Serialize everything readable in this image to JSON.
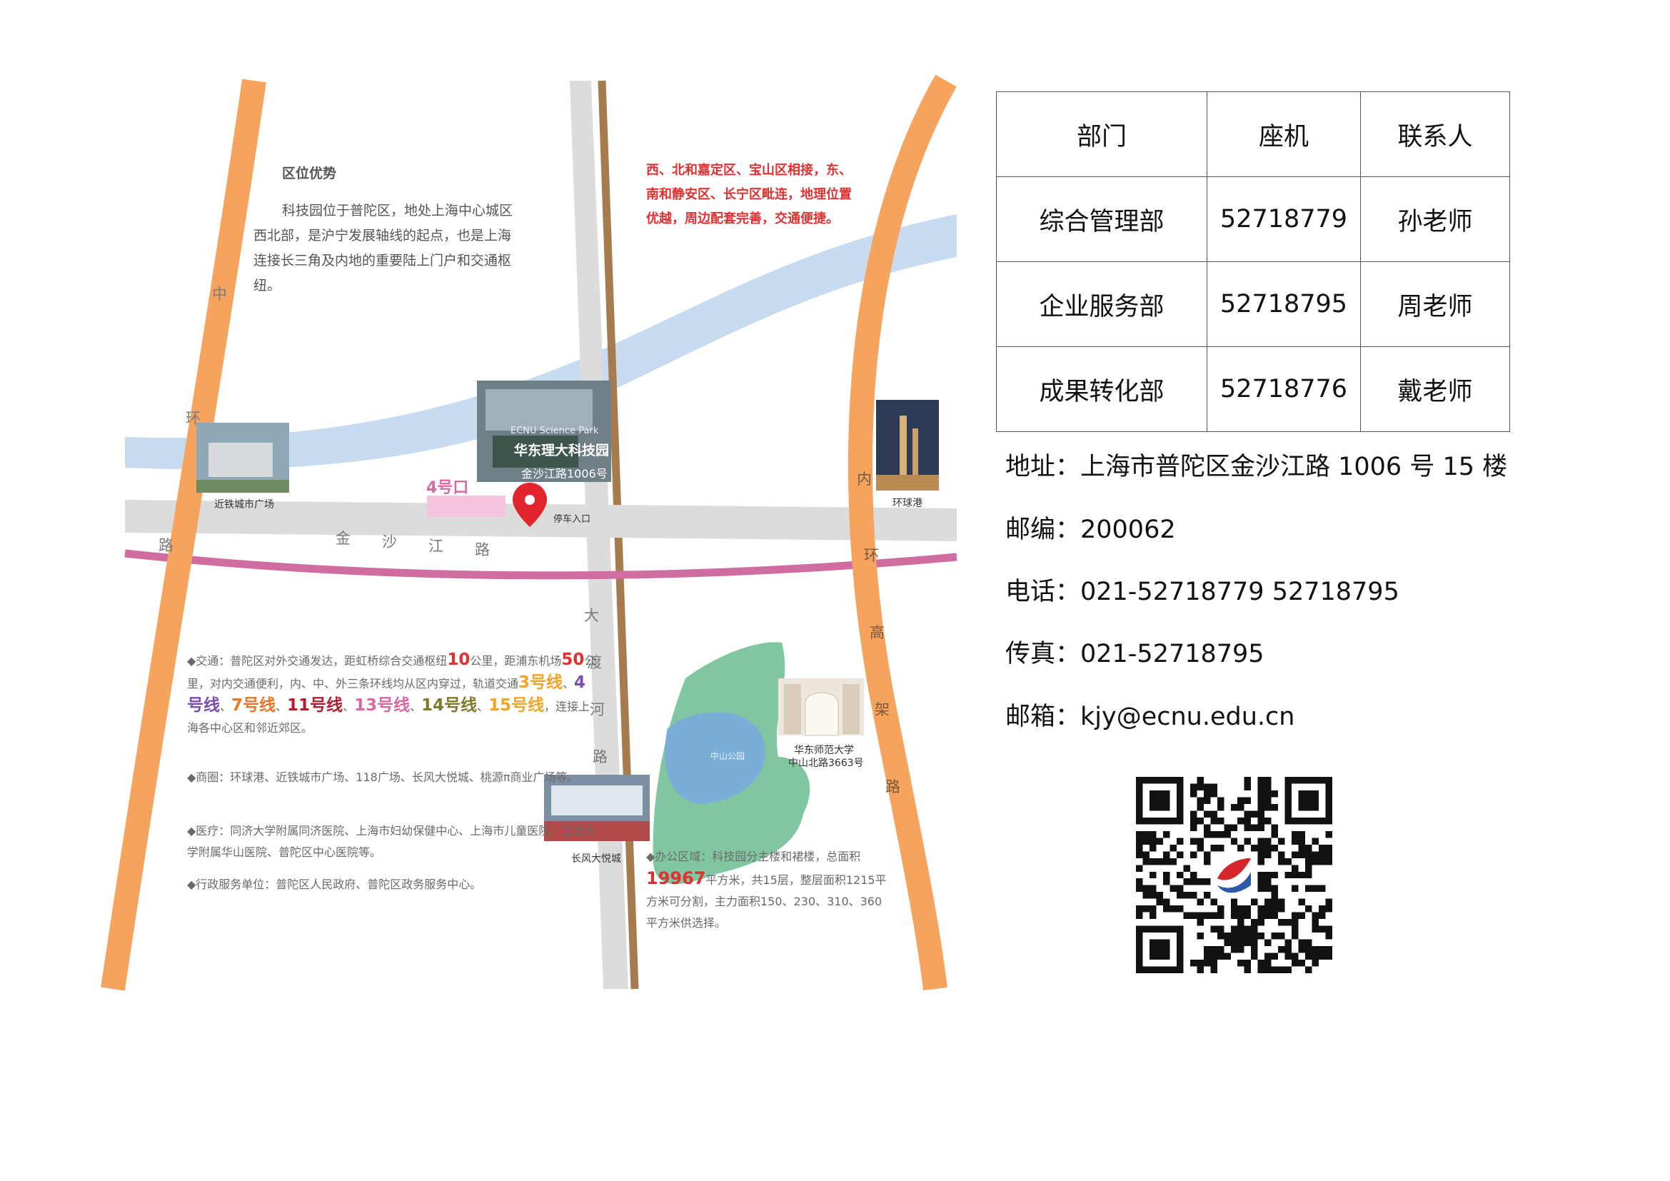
{
  "map": {
    "intro_title": "区位优势",
    "intro_body": "科技园位于普陀区，地处上海中心城区西北部，是沪宁发展轴线的起点，也是上海连接长三角及内地的重要陆上门户和交通枢纽。",
    "red_text": "西、北和嘉定区、宝山区相接，东、南和静安区、长宁区毗连，地理位置优越，周边配套完善，交通便捷。",
    "road_zhonghuan": [
      "中",
      "环",
      "路"
    ],
    "road_jinshajiang": [
      "金",
      "沙",
      "江",
      "路"
    ],
    "road_dadu": [
      "大",
      "渡",
      "河",
      "路"
    ],
    "road_neihuan": [
      "内",
      "环",
      "高",
      "架",
      "路"
    ],
    "gate_label": "4号口",
    "parking_label": "停车入口",
    "landmark_jintie": "近铁城市广场",
    "landmark_huanqiu": "环球港",
    "landmark_changfeng": "长风大悦城",
    "landmark_ecnu_1": "华东师范大学",
    "landmark_ecnu_2": "中山北路3663号",
    "building_en": "ECNU Science Park",
    "building_cn": "华东理大科技园",
    "building_addr": "金沙江路1006号",
    "lake_label": "中山公园",
    "traffic": {
      "p1": "◆交通：普陀区对外交通发达，距虹桥综合交通枢纽",
      "n1": "10",
      "p2": "公里，距浦东机场",
      "n2": "50",
      "p3": "公里，对内交通便利，内、中、外三条环线均从区内穿过，轨道交通",
      "l3": "3号线",
      "sep1": "、",
      "l4": "4号线",
      "sep2": "、",
      "l7": "7号线",
      "sep3": "、",
      "l11": "11号线",
      "sep4": "、",
      "l13": "13号线",
      "sep5": "、",
      "l14": "14号线",
      "sep6": "、",
      "l15": "15号线",
      "p4": "，连接上海各中心区和邻近郊区。"
    },
    "commerce": "◆商圈：环球港、近铁城市广场、118广场、长风大悦城、桃源π商业广场等。",
    "medical": "◆医疗：同济大学附属同济医院、上海市妇幼保健中心、上海市儿童医院、复旦大学附属华山医院、普陀区中心医院等。",
    "admin": "◆行政服务单位：普陀区人民政府、普陀区政务服务中心。",
    "office": {
      "p1": "◆办公区域：科技园分主楼和裙楼，总面积",
      "n": "19967",
      "p2": "平方米，共15层，整层面积1215平方米可分割，主力面积150、230、310、360平方米供选择。"
    }
  },
  "contacts": {
    "headers": [
      "部门",
      "座机",
      "联系人"
    ],
    "rows": [
      [
        "综合管理部",
        "52718779",
        "孙老师"
      ],
      [
        "企业服务部",
        "52718795",
        "周老师"
      ],
      [
        "成果转化部",
        "52718776",
        "戴老师"
      ]
    ]
  },
  "info": {
    "address": "地址：上海市普陀区金沙江路 1006 号 15 楼",
    "postcode": "邮编：200062",
    "phone": "电话：021-52718779 52718795",
    "fax": "传真：021-52718795",
    "email": "邮箱：kjy@ecnu.edu.cn"
  },
  "colors": {
    "orange_road": "#f6a35d",
    "river": "#c7dcf0",
    "grey_road": "#dcdcdc",
    "metro_line": "#cf6da0",
    "brown_road": "#a67c4e"
  }
}
